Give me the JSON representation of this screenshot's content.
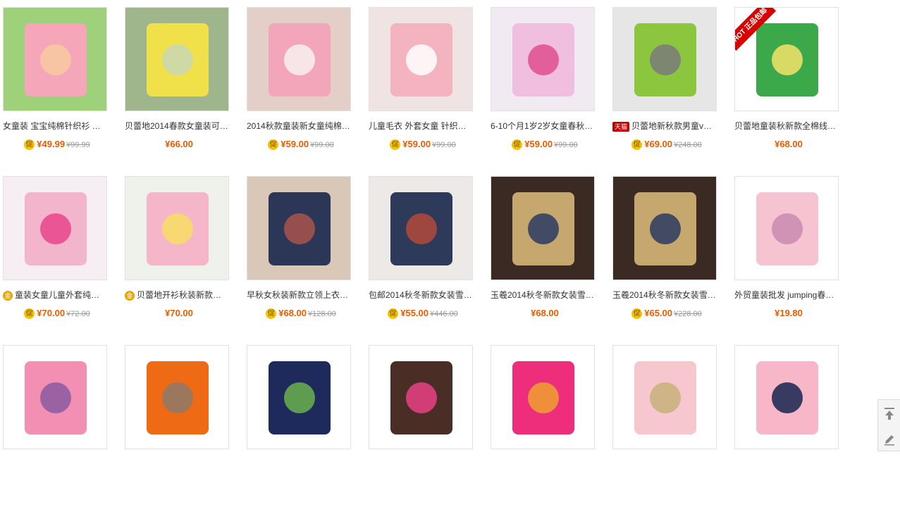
{
  "products": [
    {
      "title": "女童装 宝宝纯棉针织衫 …",
      "price": "¥49.99",
      "original": "¥99.99",
      "promo": true,
      "tag": "",
      "colors": [
        "#9fd07a",
        "#f5a6b9",
        "#f7c9a0"
      ]
    },
    {
      "title": "贝蕾地2014春款女童装可…",
      "price": "¥66.00",
      "original": "",
      "promo": false,
      "tag": "",
      "colors": [
        "#9fb58c",
        "#f0e04a",
        "#c8d7b5"
      ]
    },
    {
      "title": "2014秋款童装新女童纯棉…",
      "price": "¥59.00",
      "original": "¥99.00",
      "promo": true,
      "tag": "",
      "colors": [
        "#e3cfc8",
        "#f3a6b9",
        "#f8f0f0"
      ]
    },
    {
      "title": "儿童毛衣 外套女童 针织…",
      "price": "¥59.00",
      "original": "¥99.00",
      "promo": true,
      "tag": "",
      "colors": [
        "#f0e3e3",
        "#f3b3bf",
        "#ffffff"
      ]
    },
    {
      "title": "6-10个月1岁2岁女童春秋…",
      "price": "¥59.00",
      "original": "¥99.00",
      "promo": true,
      "tag": "",
      "colors": [
        "#f2eaf2",
        "#f0bfe0",
        "#e04e8e"
      ]
    },
    {
      "title": "贝蕾地新秋款男童v…",
      "price": "¥69.00",
      "original": "¥248.00",
      "promo": true,
      "tag": "tmall",
      "tag_text": "天猫",
      "colors": [
        "#e6e6e6",
        "#8cc63f",
        "#7a7a7a"
      ]
    },
    {
      "title": "贝蕾地童装秋新款全棉线…",
      "price": "¥68.00",
      "original": "",
      "promo": false,
      "tag": "",
      "colors": [
        "#ffffff",
        "#3ba84a",
        "#f6e26a"
      ],
      "hot_badge": "HOT 正品包邮"
    },
    {
      "title": "童装女童儿童外套纯…",
      "price": "¥70.00",
      "original": "¥72.00",
      "promo": true,
      "tag": "gold",
      "tag_text": "金",
      "colors": [
        "#f6eef2",
        "#f3b5cb",
        "#e8458c"
      ]
    },
    {
      "title": "贝蕾地开衫秋装新款…",
      "price": "¥70.00",
      "original": "",
      "promo": false,
      "tag": "gold",
      "tag_text": "金",
      "colors": [
        "#eef2ea",
        "#f4b6c8",
        "#f7de64"
      ]
    },
    {
      "title": "早秋女秋装新款立领上衣…",
      "price": "¥68.00",
      "original": "¥128.00",
      "promo": true,
      "tag": "",
      "colors": [
        "#d9c7b8",
        "#2c3656",
        "#a9534a"
      ]
    },
    {
      "title": "包邮2014秋冬新款女装雪…",
      "price": "¥55.00",
      "original": "¥446.00",
      "promo": true,
      "tag": "",
      "colors": [
        "#ece9e6",
        "#2d3a5a",
        "#b24a3a"
      ]
    },
    {
      "title": "玉羲2014秋冬新款女装雪…",
      "price": "¥68.00",
      "original": "",
      "promo": false,
      "tag": "",
      "colors": [
        "#3b2a24",
        "#c6a86e",
        "#2b3a63"
      ]
    },
    {
      "title": "玉羲2014秋冬新款女装雪…",
      "price": "¥65.00",
      "original": "¥228.00",
      "promo": true,
      "tag": "",
      "colors": [
        "#3b2a24",
        "#c6a86e",
        "#2b3a63"
      ]
    },
    {
      "title": "外贸童装批发 jumping春…",
      "price": "¥19.80",
      "original": "",
      "promo": false,
      "tag": "",
      "colors": [
        "#ffffff",
        "#f6c3d0",
        "#c98ab0"
      ]
    },
    {
      "title": "",
      "price": "",
      "original": "",
      "promo": false,
      "tag": "",
      "colors": [
        "#ffffff",
        "#f28fb2",
        "#8b5aa0"
      ]
    },
    {
      "title": "",
      "price": "",
      "original": "",
      "promo": false,
      "tag": "",
      "colors": [
        "#ffffff",
        "#ef6a15",
        "#8c7a6a"
      ]
    },
    {
      "title": "",
      "price": "",
      "original": "",
      "promo": false,
      "tag": "",
      "colors": [
        "#ffffff",
        "#1f2a5c",
        "#6ab04c"
      ]
    },
    {
      "title": "",
      "price": "",
      "original": "",
      "promo": false,
      "tag": "",
      "colors": [
        "#ffffff",
        "#4a2e25",
        "#e83f86"
      ]
    },
    {
      "title": "",
      "price": "",
      "original": "",
      "promo": false,
      "tag": "",
      "colors": [
        "#ffffff",
        "#ee2e7a",
        "#f0a030"
      ]
    },
    {
      "title": "",
      "price": "",
      "original": "",
      "promo": false,
      "tag": "",
      "colors": [
        "#ffffff",
        "#f6c7cf",
        "#c7b07a"
      ]
    },
    {
      "title": "",
      "price": "",
      "original": "",
      "promo": false,
      "tag": "",
      "colors": [
        "#ffffff",
        "#f7b7c8",
        "#16244f"
      ]
    }
  ],
  "promo_icon_text": "促",
  "sidebar": {
    "top_icon": "arrow-up-to-top-icon",
    "edit_icon": "pencil-edit-icon"
  }
}
